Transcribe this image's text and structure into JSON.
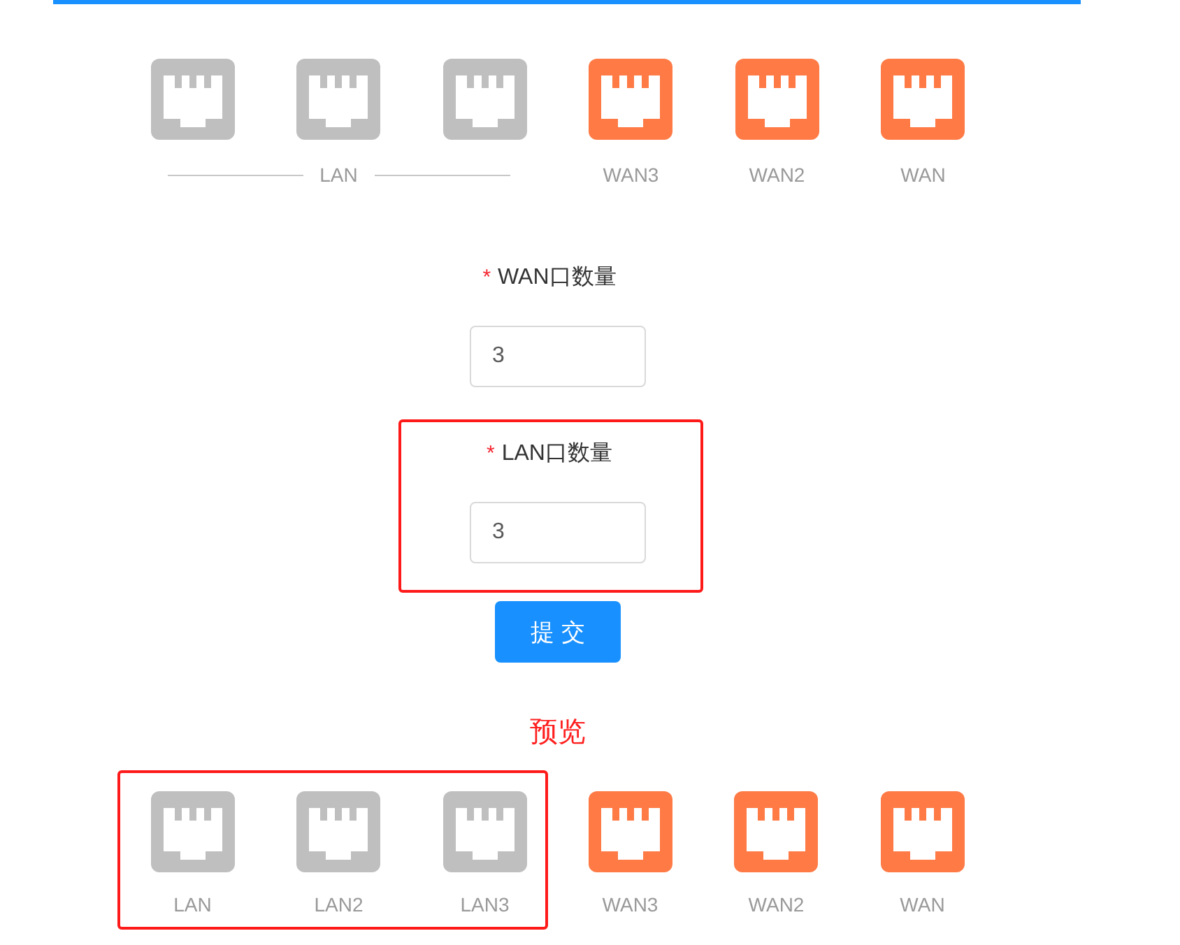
{
  "port_panel": {
    "lan_group": {
      "label": "LAN",
      "ports": [
        {
          "kind": "lan"
        },
        {
          "kind": "lan"
        },
        {
          "kind": "lan"
        }
      ]
    },
    "wan_ports": [
      {
        "kind": "wan",
        "label": "WAN3"
      },
      {
        "kind": "wan",
        "label": "WAN2"
      },
      {
        "kind": "wan",
        "label": "WAN"
      }
    ]
  },
  "form": {
    "fields": [
      {
        "required_mark": "*",
        "label": "WAN口数量",
        "value": "3",
        "highlighted": false
      },
      {
        "required_mark": "*",
        "label": "LAN口数量",
        "value": "3",
        "highlighted": true
      }
    ],
    "submit_button": "提 交"
  },
  "preview": {
    "title": "预览",
    "groups": [
      {
        "highlighted": true,
        "ports": [
          {
            "kind": "lan",
            "label": "LAN"
          },
          {
            "kind": "lan",
            "label": "LAN2"
          },
          {
            "kind": "lan",
            "label": "LAN3"
          }
        ]
      },
      {
        "highlighted": false,
        "ports": [
          {
            "kind": "wan",
            "label": "WAN3"
          },
          {
            "kind": "wan",
            "label": "WAN2"
          },
          {
            "kind": "wan",
            "label": "WAN"
          }
        ]
      }
    ]
  }
}
